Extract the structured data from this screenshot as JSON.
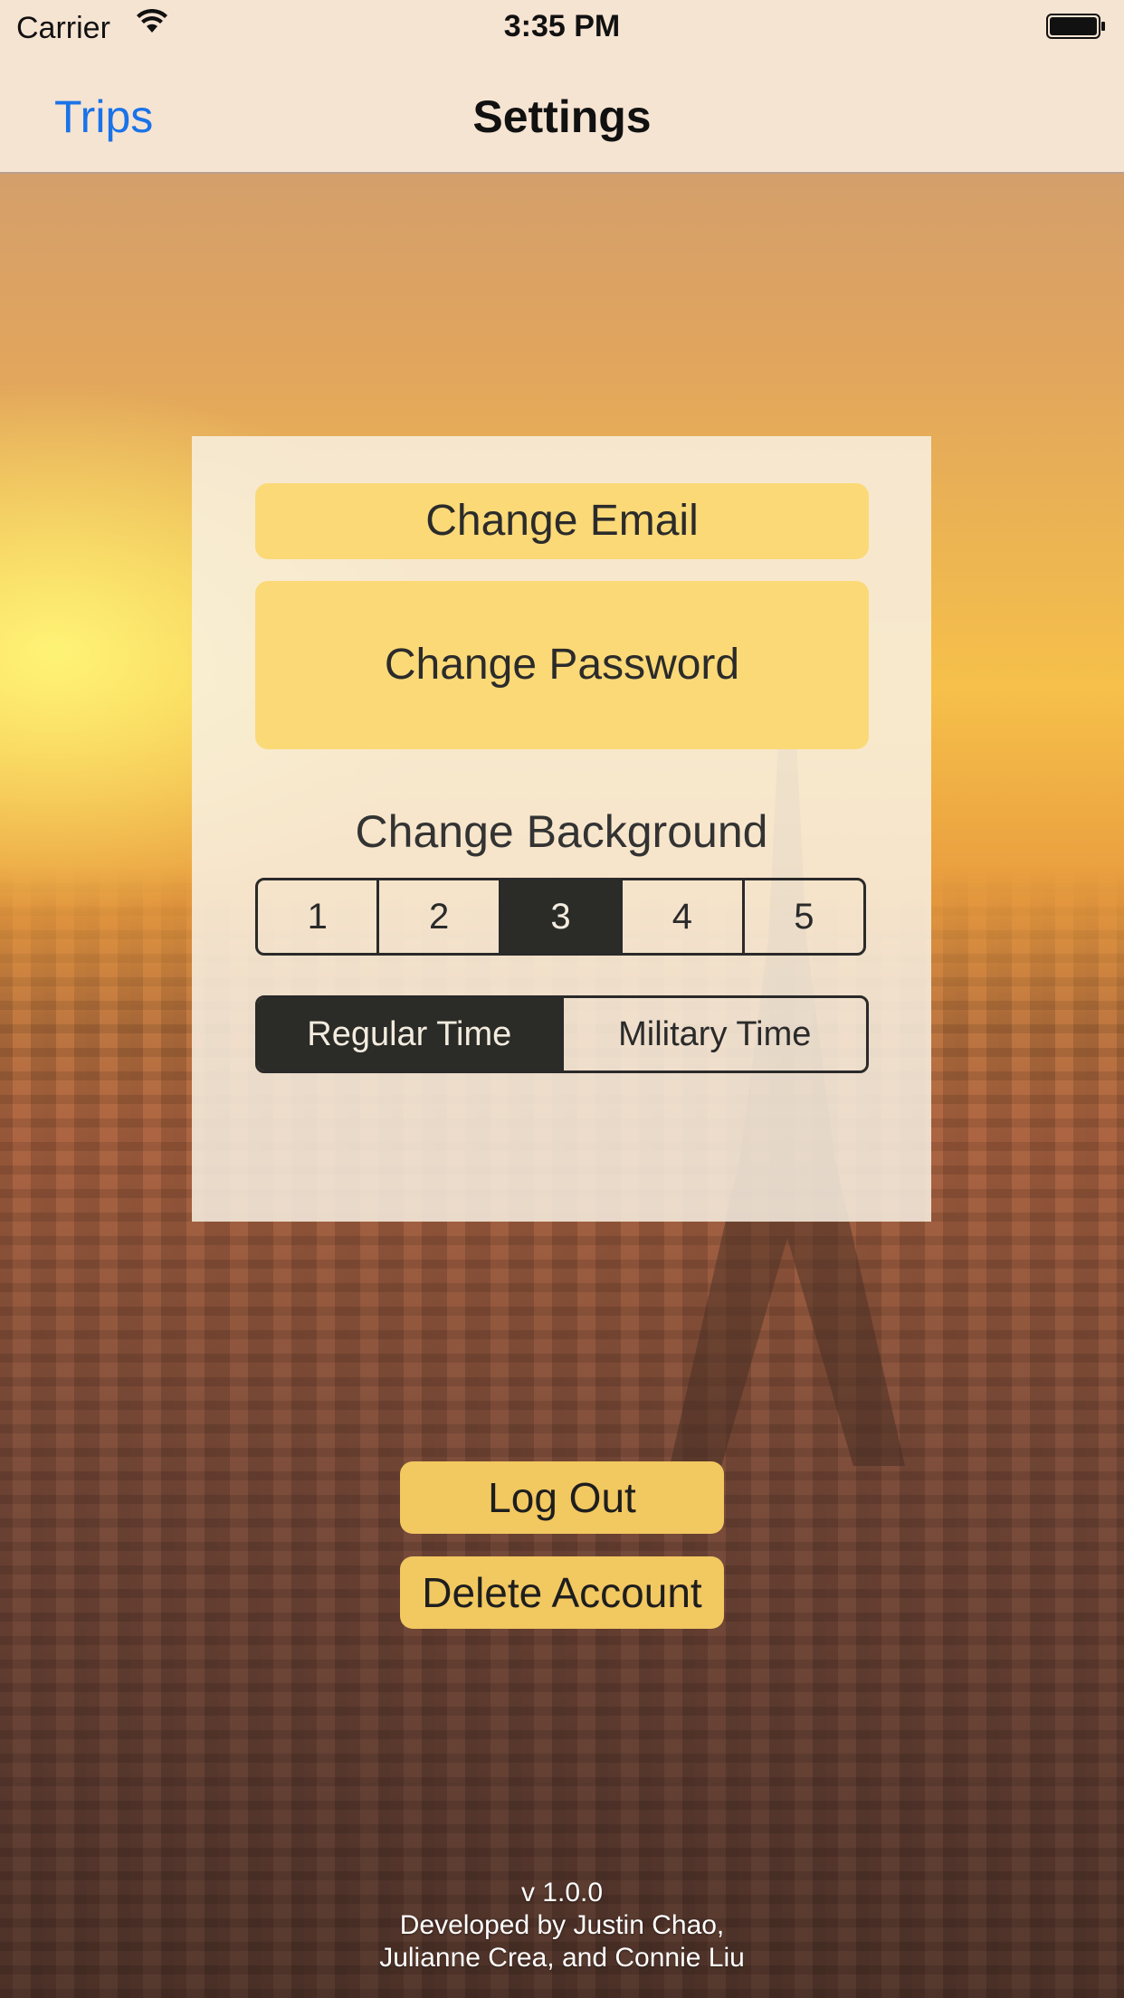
{
  "status_bar": {
    "carrier": "Carrier",
    "time": "3:35 PM"
  },
  "nav": {
    "back_label": "Trips",
    "title": "Settings"
  },
  "settings": {
    "change_email_label": "Change Email",
    "change_password_label": "Change Password",
    "change_background_label": "Change Background",
    "background_options": [
      "1",
      "2",
      "3",
      "4",
      "5"
    ],
    "background_selected": "3",
    "time_options": [
      "Regular Time",
      "Military Time"
    ],
    "time_selected": "Regular Time"
  },
  "actions": {
    "log_out_label": "Log Out",
    "delete_account_label": "Delete Account"
  },
  "footer": {
    "version": "v 1.0.0",
    "credits_line1": "Developed by Justin Chao,",
    "credits_line2": "Julianne Crea, and Connie Liu"
  },
  "colors": {
    "accent_blue": "#1a73e8",
    "button_yellow": "#fbd977",
    "segment_dark": "#2b2b27"
  }
}
